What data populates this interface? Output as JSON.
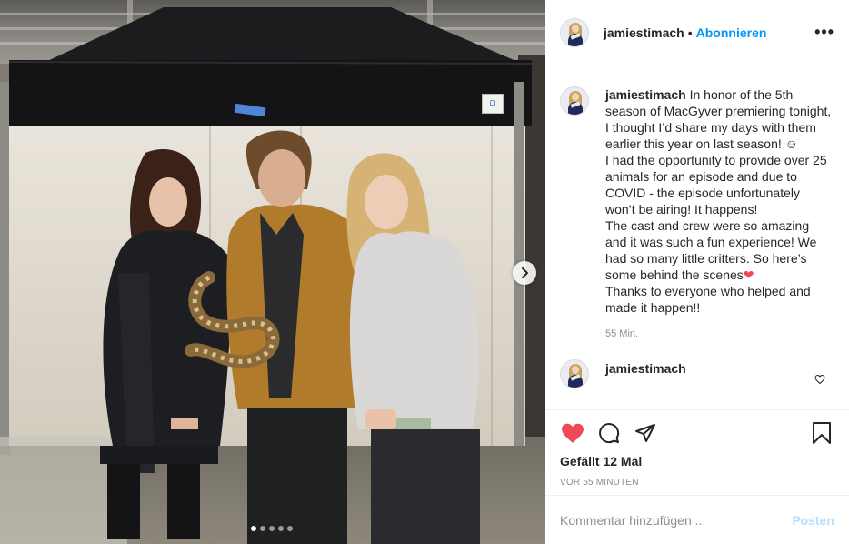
{
  "post": {
    "image_alt": "Three people standing in front of a white backdrop under a black tent, the man in the middle holding a snake",
    "carousel": {
      "total_slides": 5,
      "active_slide": 1
    }
  },
  "header": {
    "username": "jamiestimach",
    "separator": "•",
    "follow_label": "Abonnieren",
    "more_icon": "more-options-icon",
    "more_label": "•••"
  },
  "caption": {
    "username": "jamiestimach",
    "lines": [
      "In honor of the 5th season of MacGyver premiering tonight, I thought I’d share my days with them earlier this year on last season! ☺",
      "I had the opportunity to provide over 25 animals for an episode and due to COVID - the episode unfortunately won’t be airing! It happens!",
      "The cast and crew were so amazing and it was such a fun experience! We had so many little critters. So here’s some behind the scenes",
      "Thanks to everyone who helped and made it happen!!"
    ],
    "heart_emoji": "❤",
    "time": "55 Min."
  },
  "comment": {
    "username": "jamiestimach"
  },
  "actions": {
    "like_icon": "heart-filled-icon",
    "comment_icon": "comment-icon",
    "share_icon": "share-icon",
    "save_icon": "bookmark-icon",
    "like_color": "#ed4956"
  },
  "likes_label": "Gefällt 12 Mal",
  "time_ago": "VOR 55 MINUTEN",
  "comment_input": {
    "placeholder": "Kommentar hinzufügen ...",
    "post_label": "Posten"
  },
  "colors": {
    "accent": "#0095f6",
    "post_disabled": "#b2dffc",
    "muted": "#8e8e8e"
  }
}
